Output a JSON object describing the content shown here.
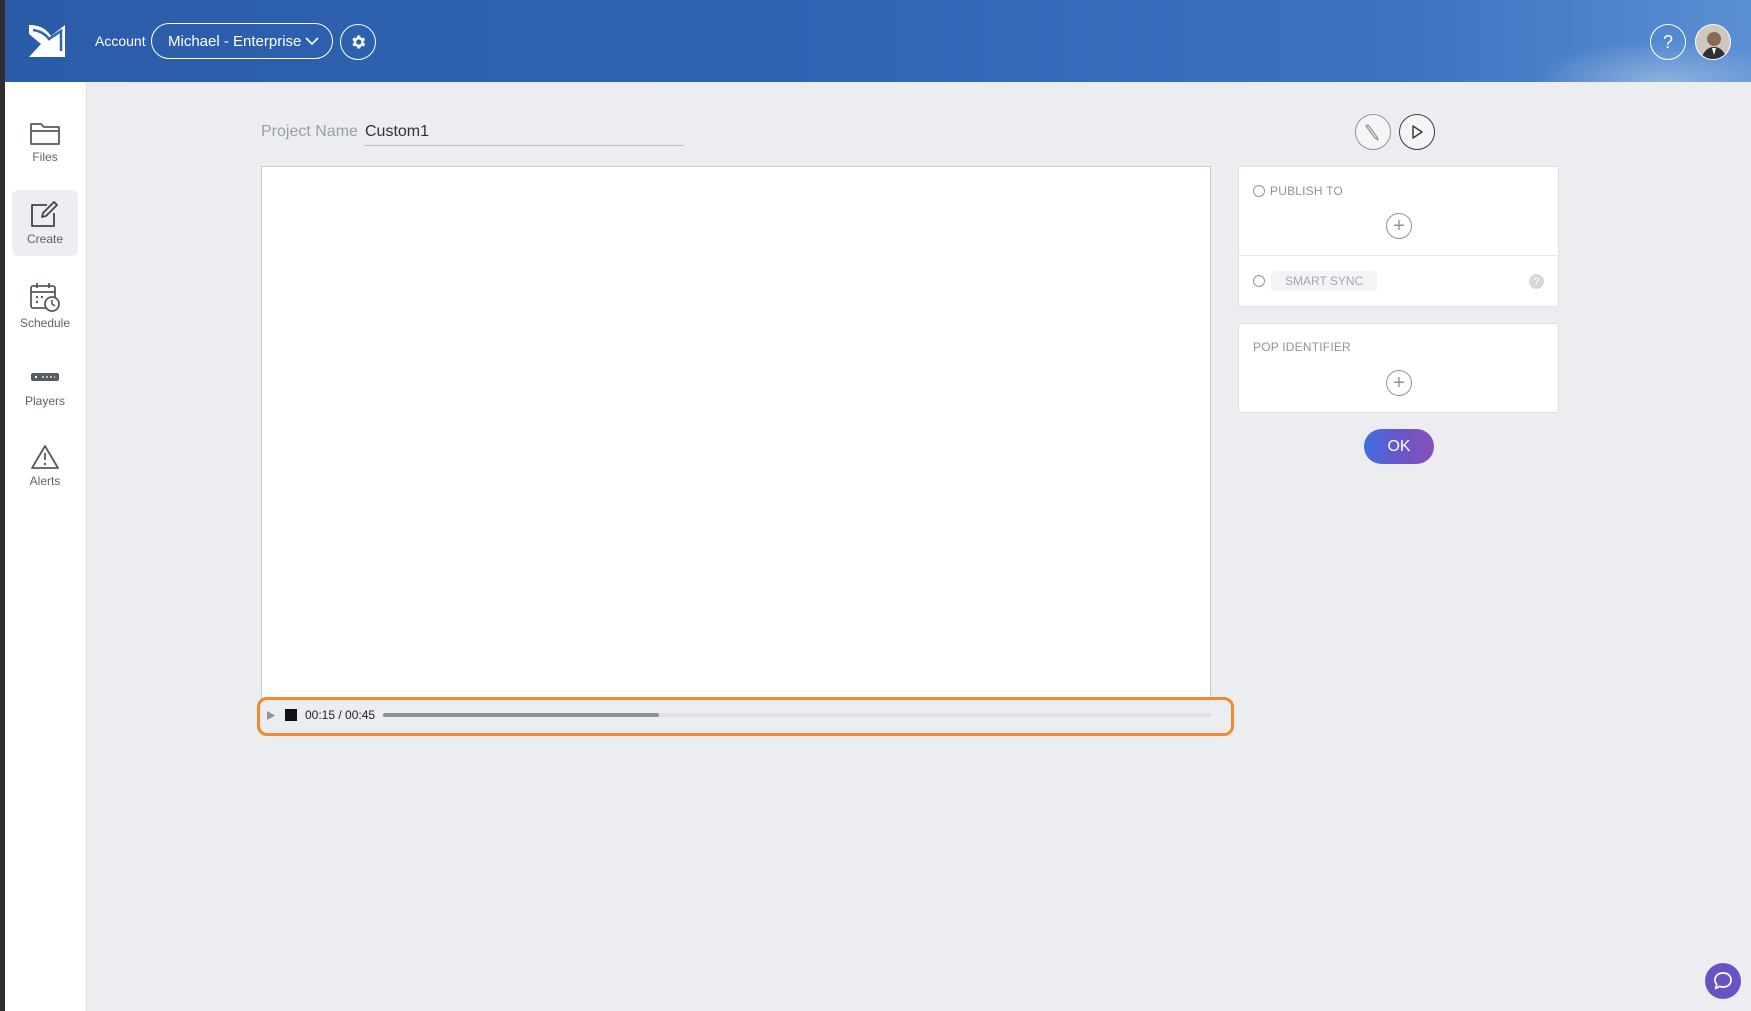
{
  "header": {
    "account_label": "Account",
    "account_value": "Michael - Enterprise",
    "help_label": "?"
  },
  "sidebar": {
    "items": [
      {
        "label": "Files",
        "icon": "folder-icon"
      },
      {
        "label": "Create",
        "icon": "edit-square-icon",
        "active": true
      },
      {
        "label": "Schedule",
        "icon": "calendar-clock-icon"
      },
      {
        "label": "Players",
        "icon": "player-device-icon"
      },
      {
        "label": "Alerts",
        "icon": "warning-icon"
      }
    ]
  },
  "project": {
    "label": "Project Name",
    "value": "Custom1"
  },
  "player": {
    "time": "00:15 / 00:45",
    "progress_fraction": 0.333
  },
  "publish": {
    "title": "PUBLISH TO",
    "smart_sync_label": "SMART SYNC",
    "help_label": "?"
  },
  "pop": {
    "title": "POP IDENTIFIER"
  },
  "actions": {
    "ok_label": "OK"
  },
  "colors": {
    "header": "#2f64b3",
    "highlight": "#f08a2c",
    "ok_gradient_start": "#3f6ee0",
    "ok_gradient_end": "#8750b8",
    "chat": "#6953c4"
  }
}
